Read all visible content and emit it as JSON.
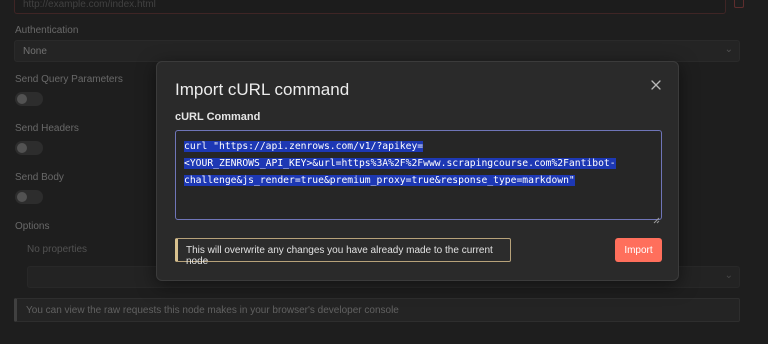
{
  "background": {
    "url_value": "http://example.com/index.html",
    "authentication_label": "Authentication",
    "authentication_value": "None",
    "send_query_label": "Send Query Parameters",
    "send_headers_label": "Send Headers",
    "send_body_label": "Send Body",
    "options_label": "Options",
    "no_properties": "No properties",
    "info_text": "You can view the raw requests this node makes in your browser's developer console",
    "toggles": {
      "send_query": false,
      "send_headers": false,
      "send_body": false
    }
  },
  "modal": {
    "title": "Import cURL command",
    "field_label": "cURL Command",
    "curl_lines": [
      "curl \"https://api.zenrows.com/v1/?apikey=",
      "<YOUR_ZENROWS_API_KEY>&url=https%3A%2F%2Fwww.scrapingcourse.com%2Fantibot-",
      "challenge&js_render=true&premium_proxy=true&response_type=markdown\""
    ],
    "warning_text": "This will overwrite any changes you have already made to the current node",
    "import_label": "Import",
    "close_icon": "close-icon"
  },
  "colors": {
    "accent": "#ff6f5c",
    "selection": "#1d38b4",
    "warning_border": "#d8c18f",
    "focus_border": "#6f75b8"
  }
}
